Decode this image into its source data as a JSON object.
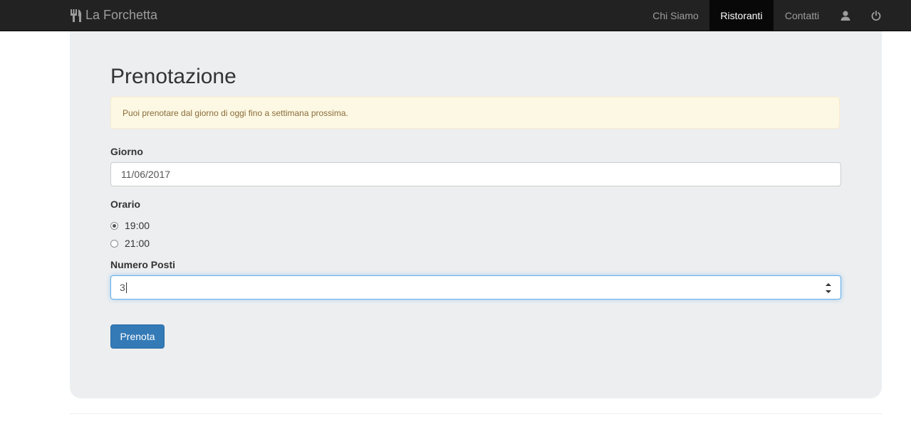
{
  "navbar": {
    "brand": "La Forchetta",
    "brand_icon": "cutlery-icon",
    "items": [
      {
        "label": "Chi Siamo",
        "active": false
      },
      {
        "label": "Ristoranti",
        "active": true
      },
      {
        "label": "Contatti",
        "active": false
      }
    ],
    "icons": [
      "user-icon",
      "power-icon"
    ]
  },
  "form": {
    "title": "Prenotazione",
    "alert": "Puoi prenotare dal giorno di oggi fino a settimana prossima.",
    "giorno": {
      "label": "Giorno",
      "value": "11/06/2017"
    },
    "orario": {
      "label": "Orario",
      "options": [
        {
          "label": "19:00",
          "checked": true
        },
        {
          "label": "21:00",
          "checked": false
        }
      ]
    },
    "posti": {
      "label": "Numero Posti",
      "value": "3"
    },
    "submit_label": "Prenota"
  },
  "colors": {
    "navbar_bg": "#222222",
    "jumbotron_bg": "#eceef0",
    "alert_bg": "#fcf8e3",
    "primary": "#337ab7"
  }
}
